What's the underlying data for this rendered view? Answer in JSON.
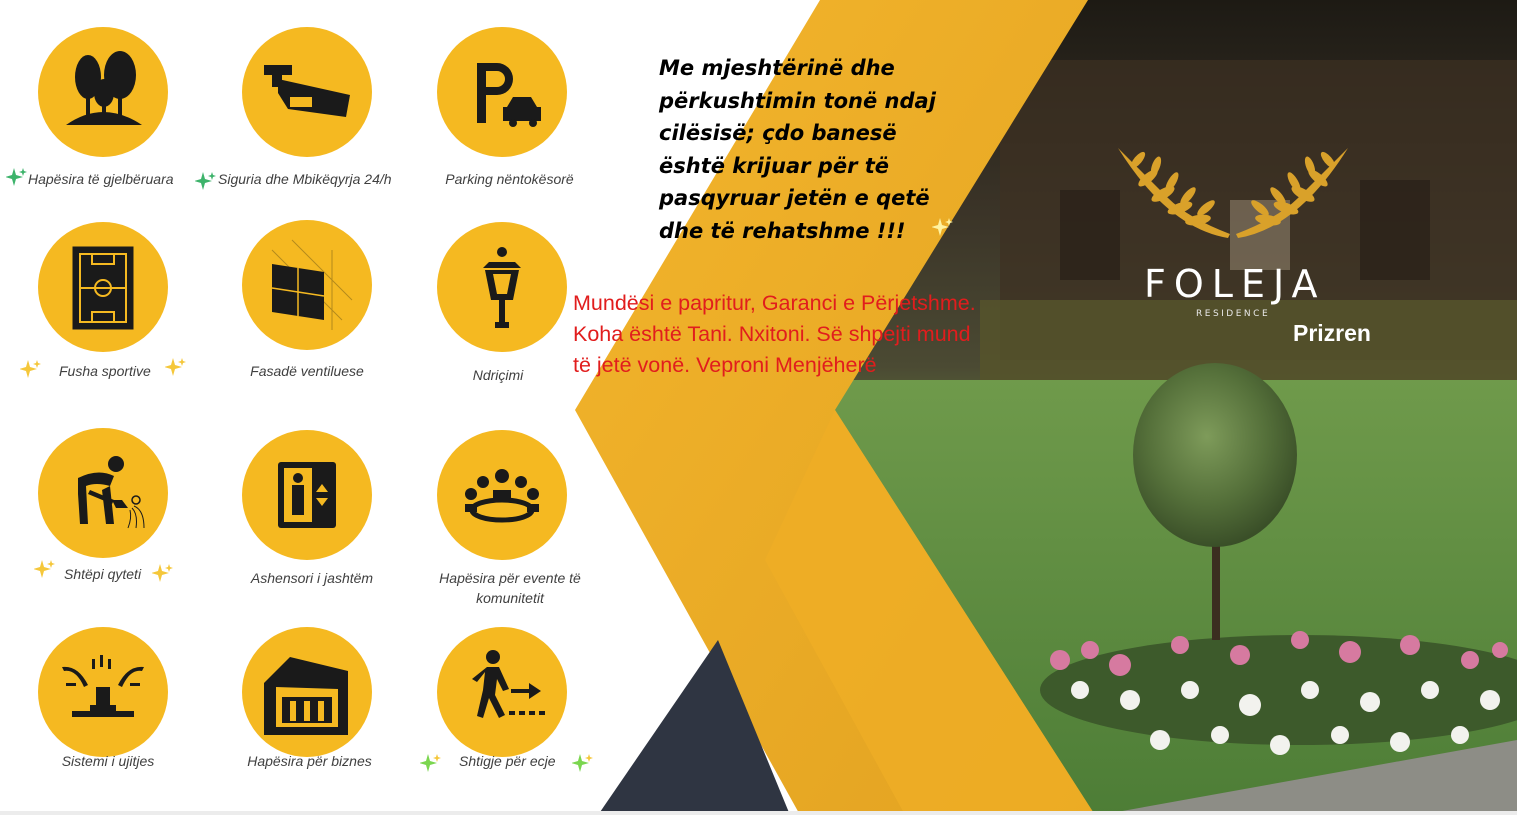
{
  "colors": {
    "accent": "#f5b921",
    "dark": "#2f3542",
    "promo_text": "#e11d1d",
    "label_text": "#404040"
  },
  "features": [
    {
      "label": "Hapësira të gjelbëruara",
      "icon": "trees-icon"
    },
    {
      "label": "Siguria dhe Mbikëqyrja 24/h",
      "icon": "security-camera-icon"
    },
    {
      "label": "Parking nëntokësorë",
      "icon": "parking-icon"
    },
    {
      "label": "Fusha sportive",
      "icon": "football-field-icon"
    },
    {
      "label": "Fasadë ventiluese",
      "icon": "facade-panel-icon"
    },
    {
      "label": "Ndriçimi",
      "icon": "street-lamp-icon"
    },
    {
      "label": "Shtëpi qyteti",
      "icon": "gardener-icon"
    },
    {
      "label": "Ashensori i jashtëm",
      "icon": "elevator-icon"
    },
    {
      "label_line1": "Hapësira për evente të",
      "label_line2": "komunitetit",
      "icon": "community-group-icon"
    },
    {
      "label": "Sistemi i ujitjes",
      "icon": "sprinkler-icon"
    },
    {
      "label": "Hapësira për biznes",
      "icon": "business-building-icon"
    },
    {
      "label": "Shtigje për ecje",
      "icon": "walking-person-icon"
    }
  ],
  "quote": {
    "lines": [
      "Me mjeshtërinë  dhe",
      "përkushtimin tonë ndaj",
      "cilësisë; çdo banesë",
      "është krijuar për të",
      "pasqyruar jetën e qetë",
      "dhe të rehatshme !!!"
    ]
  },
  "promo": {
    "lines": [
      "Mundësi e papritur, Garanci e Përjetshme.",
      "Koha është Tani. Nxitoni. Së shpejti mund",
      "të jetë vonë. Veproni Menjëherë"
    ]
  },
  "brand": {
    "name": "FOLEJA",
    "subtitle": "RESIDENCE",
    "city": "Prizren",
    "logo": "laurel-wreath-logo"
  }
}
